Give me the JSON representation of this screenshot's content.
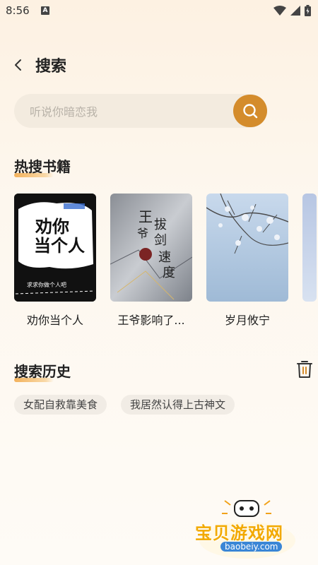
{
  "status_bar": {
    "time": "8:56",
    "notification_icon": "A"
  },
  "header": {
    "title": "搜索"
  },
  "search": {
    "placeholder": "听说你暗恋我"
  },
  "hot_books": {
    "title": "热搜书籍",
    "items": [
      {
        "title": "劝你当个人",
        "cover_text": "劝你当个人"
      },
      {
        "title": "王爷影响了...",
        "cover_text": "王爷影响了我拔剑速度"
      },
      {
        "title": "岁月攸宁",
        "cover_text": ""
      }
    ]
  },
  "history": {
    "title": "搜索历史",
    "items": [
      "女配自救靠美食",
      "我居然认得上古神文"
    ]
  },
  "watermark": {
    "text": "宝贝游戏网",
    "url": "baobeiy.com"
  },
  "colors": {
    "accent": "#d48c2c",
    "chip_bg": "#f1ece5",
    "search_bg": "#f3ebdf"
  }
}
